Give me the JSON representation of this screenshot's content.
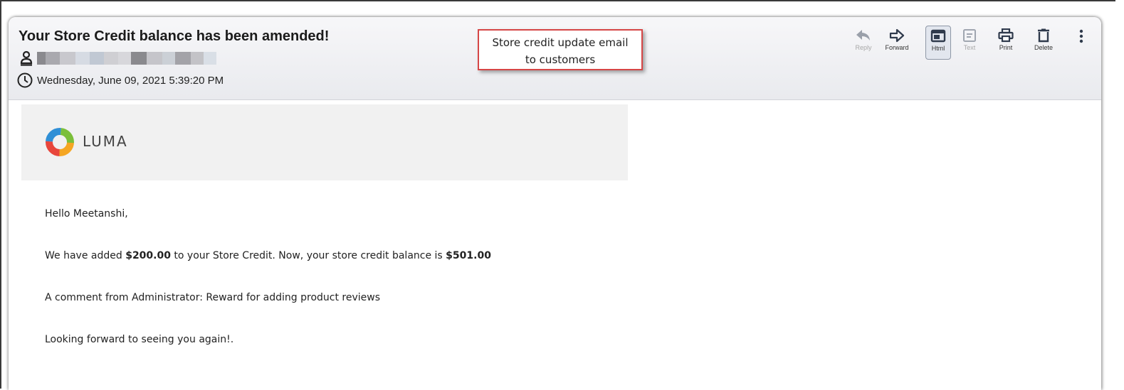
{
  "email": {
    "subject": "Your Store Credit balance has been amended!",
    "date": "Wednesday, June 09, 2021 5:39:20 PM"
  },
  "annotation": {
    "line1": "Store credit update email",
    "line2": "to customers"
  },
  "toolbar": {
    "reply": "Reply",
    "forward": "Forward",
    "html": "Html",
    "text": "Text",
    "print": "Print",
    "delete": "Delete"
  },
  "brand": {
    "logo_text": "LUMA"
  },
  "body": {
    "greeting": "Hello Meetanshi,",
    "credit_prefix": "We have added ",
    "credit_added": "$200.00",
    "credit_middle": " to your Store Credit. Now, your store credit balance is ",
    "credit_balance": "$501.00",
    "comment": "A comment from Administrator: Reward for adding product reviews",
    "closing": "Looking forward to seeing you again!."
  },
  "icons": [
    "person-icon",
    "clock-icon",
    "reply-icon",
    "forward-icon",
    "html-view-icon",
    "text-view-icon",
    "print-icon",
    "delete-icon",
    "more-options-icon",
    "luma-logo-icon"
  ],
  "colors": {
    "annotation_border": "#d64646",
    "header_bg": "#e9eaee",
    "banner_bg": "#f1f1f1"
  }
}
